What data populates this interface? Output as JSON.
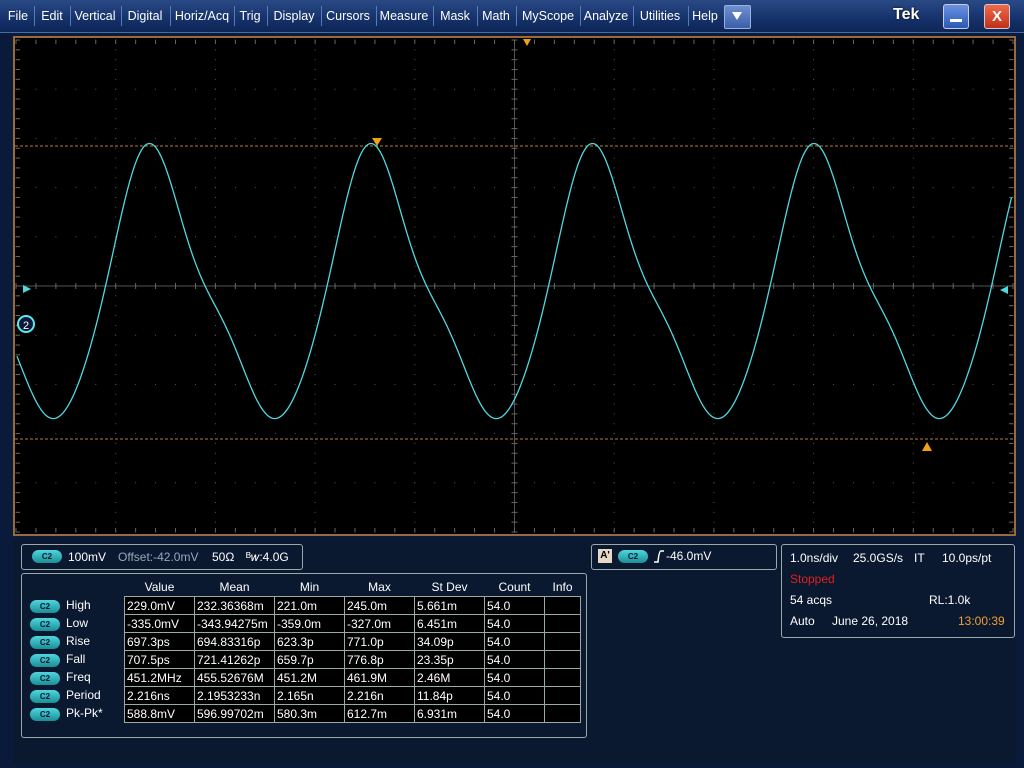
{
  "menu": {
    "items": [
      "File",
      "Edit",
      "Vertical",
      "Digital",
      "Horiz/Acq",
      "Trig",
      "Display",
      "Cursors",
      "Measure",
      "Mask",
      "Math",
      "MyScope",
      "Analyze",
      "Utilities",
      "Help"
    ],
    "brand": "Tek"
  },
  "window": {
    "close_glyph": "X"
  },
  "colors": {
    "trace": "#4fd8e0",
    "cursor": "#b87a3a",
    "grid": "#4a4a4a",
    "marker": "#f0a010"
  },
  "screen": {
    "channel_marker": "2"
  },
  "channel_readout": {
    "channel": "C2",
    "scale": "100mV",
    "offset": "Offset:-42.0mV",
    "impedance": "50Ω",
    "bandwidth": "ᴮ𝑤:4.0G"
  },
  "trigger_readout": {
    "source_label": "A'",
    "channel": "C2",
    "level": "-46.0mV"
  },
  "horizontal": {
    "timebase": "1.0ns/div",
    "sample_rate": "25.0GS/s",
    "mode": "IT",
    "resolution": "10.0ps/pt",
    "status": "Stopped",
    "acqs": "54 acqs",
    "record_length": "RL:1.0k",
    "trigger_mode": "Auto",
    "date": "June 26, 2018",
    "time": "13:00:39"
  },
  "measurements": {
    "headers": [
      "Value",
      "Mean",
      "Min",
      "Max",
      "St Dev",
      "Count",
      "Info"
    ],
    "rows": [
      {
        "source": "C2",
        "name": "High",
        "cells": [
          "229.0mV",
          "232.36368m",
          "221.0m",
          "245.0m",
          "5.661m",
          "54.0",
          ""
        ]
      },
      {
        "source": "C2",
        "name": "Low",
        "cells": [
          "-335.0mV",
          "-343.94275m",
          "-359.0m",
          "-327.0m",
          "6.451m",
          "54.0",
          ""
        ]
      },
      {
        "source": "C2",
        "name": "Rise",
        "cells": [
          "697.3ps",
          "694.83316p",
          "623.3p",
          "771.0p",
          "34.09p",
          "54.0",
          ""
        ]
      },
      {
        "source": "C2",
        "name": "Fall",
        "cells": [
          "707.5ps",
          "721.41262p",
          "659.7p",
          "776.8p",
          "23.35p",
          "54.0",
          ""
        ]
      },
      {
        "source": "C2",
        "name": "Freq",
        "cells": [
          "451.2MHz",
          "455.52676M",
          "451.2M",
          "461.9M",
          "2.46M",
          "54.0",
          ""
        ]
      },
      {
        "source": "C2",
        "name": "Period",
        "cells": [
          "2.216ns",
          "2.1953233n",
          "2.165n",
          "2.216n",
          "11.84p",
          "54.0",
          ""
        ]
      },
      {
        "source": "C2",
        "name": "Pk-Pk*",
        "cells": [
          "588.8mV",
          "596.99702m",
          "580.3m",
          "612.7m",
          "6.931m",
          "54.0",
          ""
        ]
      }
    ]
  }
}
